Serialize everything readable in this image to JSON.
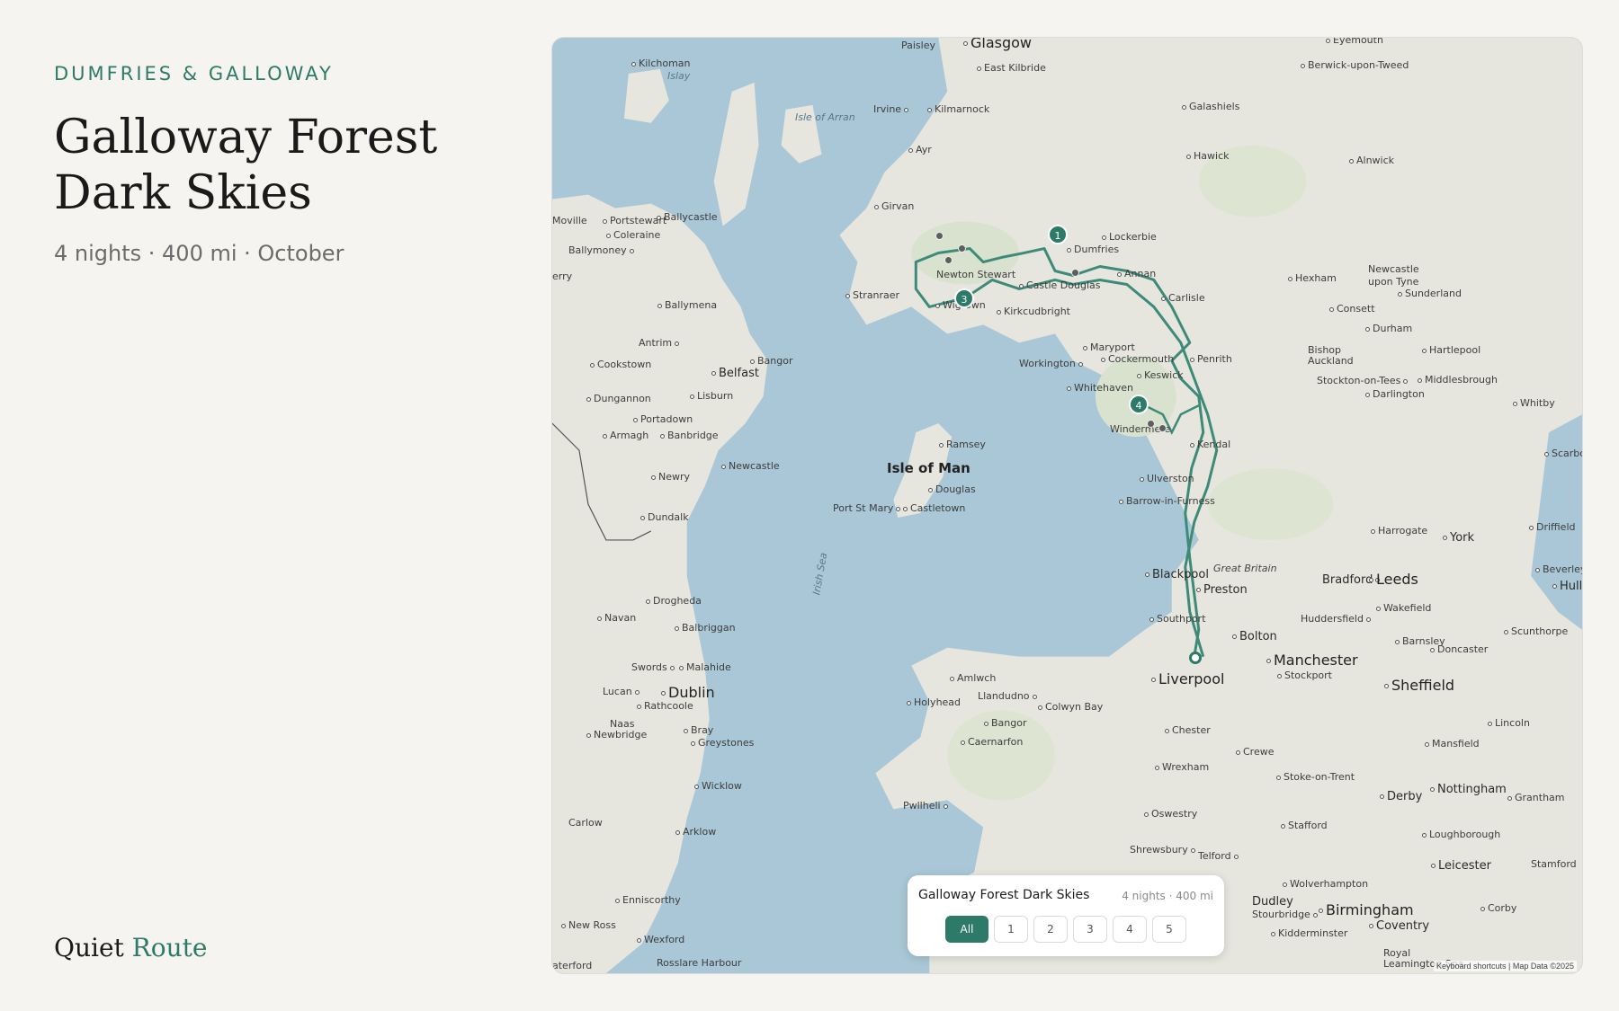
{
  "header": {
    "region": "DUMFRIES & GALLOWAY",
    "title_line1": "Galloway Forest",
    "title_line2": "Dark Skies",
    "subtitle": "4 nights · 400 mi · October"
  },
  "brand": {
    "word1": "Quiet",
    "word2": "Route"
  },
  "colors": {
    "accent": "#2e7a68",
    "background": "#f6f4f0",
    "sea": "#a9c7d6",
    "land": "#e6e6df"
  },
  "map": {
    "labels": {
      "glasgow": "Glasgow",
      "paisley": "Paisley",
      "east_kilbride": "East Kilbride",
      "kilchoman": "Kilchoman",
      "islay": "Islay",
      "isle_of_arran": "Isle of Arran",
      "irvine": "Irvine",
      "kilmarnock": "Kilmarnock",
      "ayr": "Ayr",
      "girvan": "Girvan",
      "eyemouth": "Eyemouth",
      "berwick": "Berwick-upon-Tweed",
      "galashiels": "Galashiels",
      "hawick": "Hawick",
      "alnwick": "Alnwick",
      "lockerbie": "Lockerbie",
      "dumfries": "Dumfries",
      "annan": "Annan",
      "newton_stewart": "Newton Stewart",
      "castle_douglas": "Castle Douglas",
      "stranraer": "Stranraer",
      "kirkcudbright": "Kirkcudbright",
      "wigtown": "Wigtown",
      "carlisle": "Carlisle",
      "hexham": "Hexham",
      "newcastle_upon_tyne": "Newcastle upon Tyne",
      "sunderland": "Sunderland",
      "consett": "Consett",
      "durham": "Durham",
      "bishop_auckland": "Bishop Auckland",
      "hartlepool": "Hartlepool",
      "stockton": "Stockton-on-Tees",
      "middlesbrough": "Middlesbrough",
      "darlington": "Darlington",
      "whitby": "Whitby",
      "maryport": "Maryport",
      "cockermouth": "Cockermouth",
      "workington": "Workington",
      "penrith": "Penrith",
      "keswick": "Keswick",
      "whitehaven": "Whitehaven",
      "windermere": "Windermere",
      "kendal": "Kendal",
      "ulverston": "Ulverston",
      "barrow": "Barrow-in-Furness",
      "ballycastle": "Ballycastle",
      "portstewart": "Portstewart",
      "moville": "Moville",
      "coleraine": "Coleraine",
      "ballymoney": "Ballymoney",
      "ballymena": "Ballymena",
      "antrim": "Antrim",
      "bangor_ni": "Bangor",
      "belfast": "Belfast",
      "cookstown": "Cookstown",
      "lisburn": "Lisburn",
      "dungannon": "Dungannon",
      "portadown": "Portadown",
      "armagh": "Armagh",
      "banbridge": "Banbridge",
      "newry": "Newry",
      "newcastle_ni": "Newcastle",
      "dundalk": "Dundalk",
      "isle_of_man": "Isle of Man",
      "ramsey": "Ramsey",
      "douglas": "Douglas",
      "port_st_mary": "Port St Mary",
      "castletown": "Castletown",
      "irish_sea": "Irish Sea",
      "drogheda": "Drogheda",
      "navan": "Navan",
      "balbriggan": "Balbriggan",
      "swords": "Swords",
      "malahide": "Malahide",
      "lucan": "Lucan",
      "dublin": "Dublin",
      "rathcoole": "Rathcoole",
      "naas": "Naas",
      "newbridge": "Newbridge",
      "bray": "Bray",
      "greystones": "Greystones",
      "wicklow": "Wicklow",
      "carlow": "Carlow",
      "arklow": "Arklow",
      "enniscorthy": "Enniscorthy",
      "new_ross": "New Ross",
      "wexford": "Wexford",
      "rosslare": "Rosslare Harbour",
      "scarborough": "Scarbo",
      "harrogate": "Harrogate",
      "york": "York",
      "driffield": "Driffield",
      "great_britain": "Great Britain",
      "blackpool": "Blackpool",
      "preston": "Preston",
      "bradford": "Bradford",
      "leeds": "Leeds",
      "beverley": "Beverley",
      "hull": "Hull",
      "wakefield": "Wakefield",
      "huddersfield": "Huddersfield",
      "southport": "Southport",
      "bolton": "Bolton",
      "barnsley": "Barnsley",
      "doncaster": "Doncaster",
      "scunthorpe": "Scunthorpe",
      "manchester": "Manchester",
      "stockport": "Stockport",
      "liverpool": "Liverpool",
      "sheffield": "Sheffield",
      "amlwch": "Amlwch",
      "holyhead": "Holyhead",
      "llandudno": "Llandudno",
      "colwyn_bay": "Colwyn Bay",
      "bangor_wales": "Bangor",
      "caernarfon": "Caernarfon",
      "chester": "Chester",
      "wrexham": "Wrexham",
      "crewe": "Crewe",
      "lincoln": "Lincoln",
      "mansfield": "Mansfield",
      "stoke": "Stoke-on-Trent",
      "derby": "Derby",
      "nottingham": "Nottingham",
      "grantham": "Grantham",
      "pwllheli": "Pwllheli",
      "oswestry": "Oswestry",
      "stafford": "Stafford",
      "loughborough": "Loughborough",
      "shrewsbury": "Shrewsbury",
      "telford": "Telford",
      "leicester": "Leicester",
      "stamford": "Stamford",
      "wolverhampton": "Wolverhampton",
      "dudley": "Dudley",
      "birmingham": "Birmingham",
      "stourbridge": "Stourbridge",
      "coventry": "Coventry",
      "corby": "Corby",
      "kidderminster": "Kidderminster",
      "royal_leamington": "Royal Leamington Spa",
      "waterford": "aterford",
      "derry": "erry"
    },
    "markers": [
      "1",
      "3",
      "4"
    ],
    "attribution": "Keyboard shortcuts | Map Data ©2025"
  },
  "trip_card": {
    "title": "Galloway Forest Dark Skies",
    "meta": "4 nights · 400 mi",
    "day_buttons": [
      "All",
      "1",
      "2",
      "3",
      "4",
      "5"
    ],
    "selected": "All"
  }
}
